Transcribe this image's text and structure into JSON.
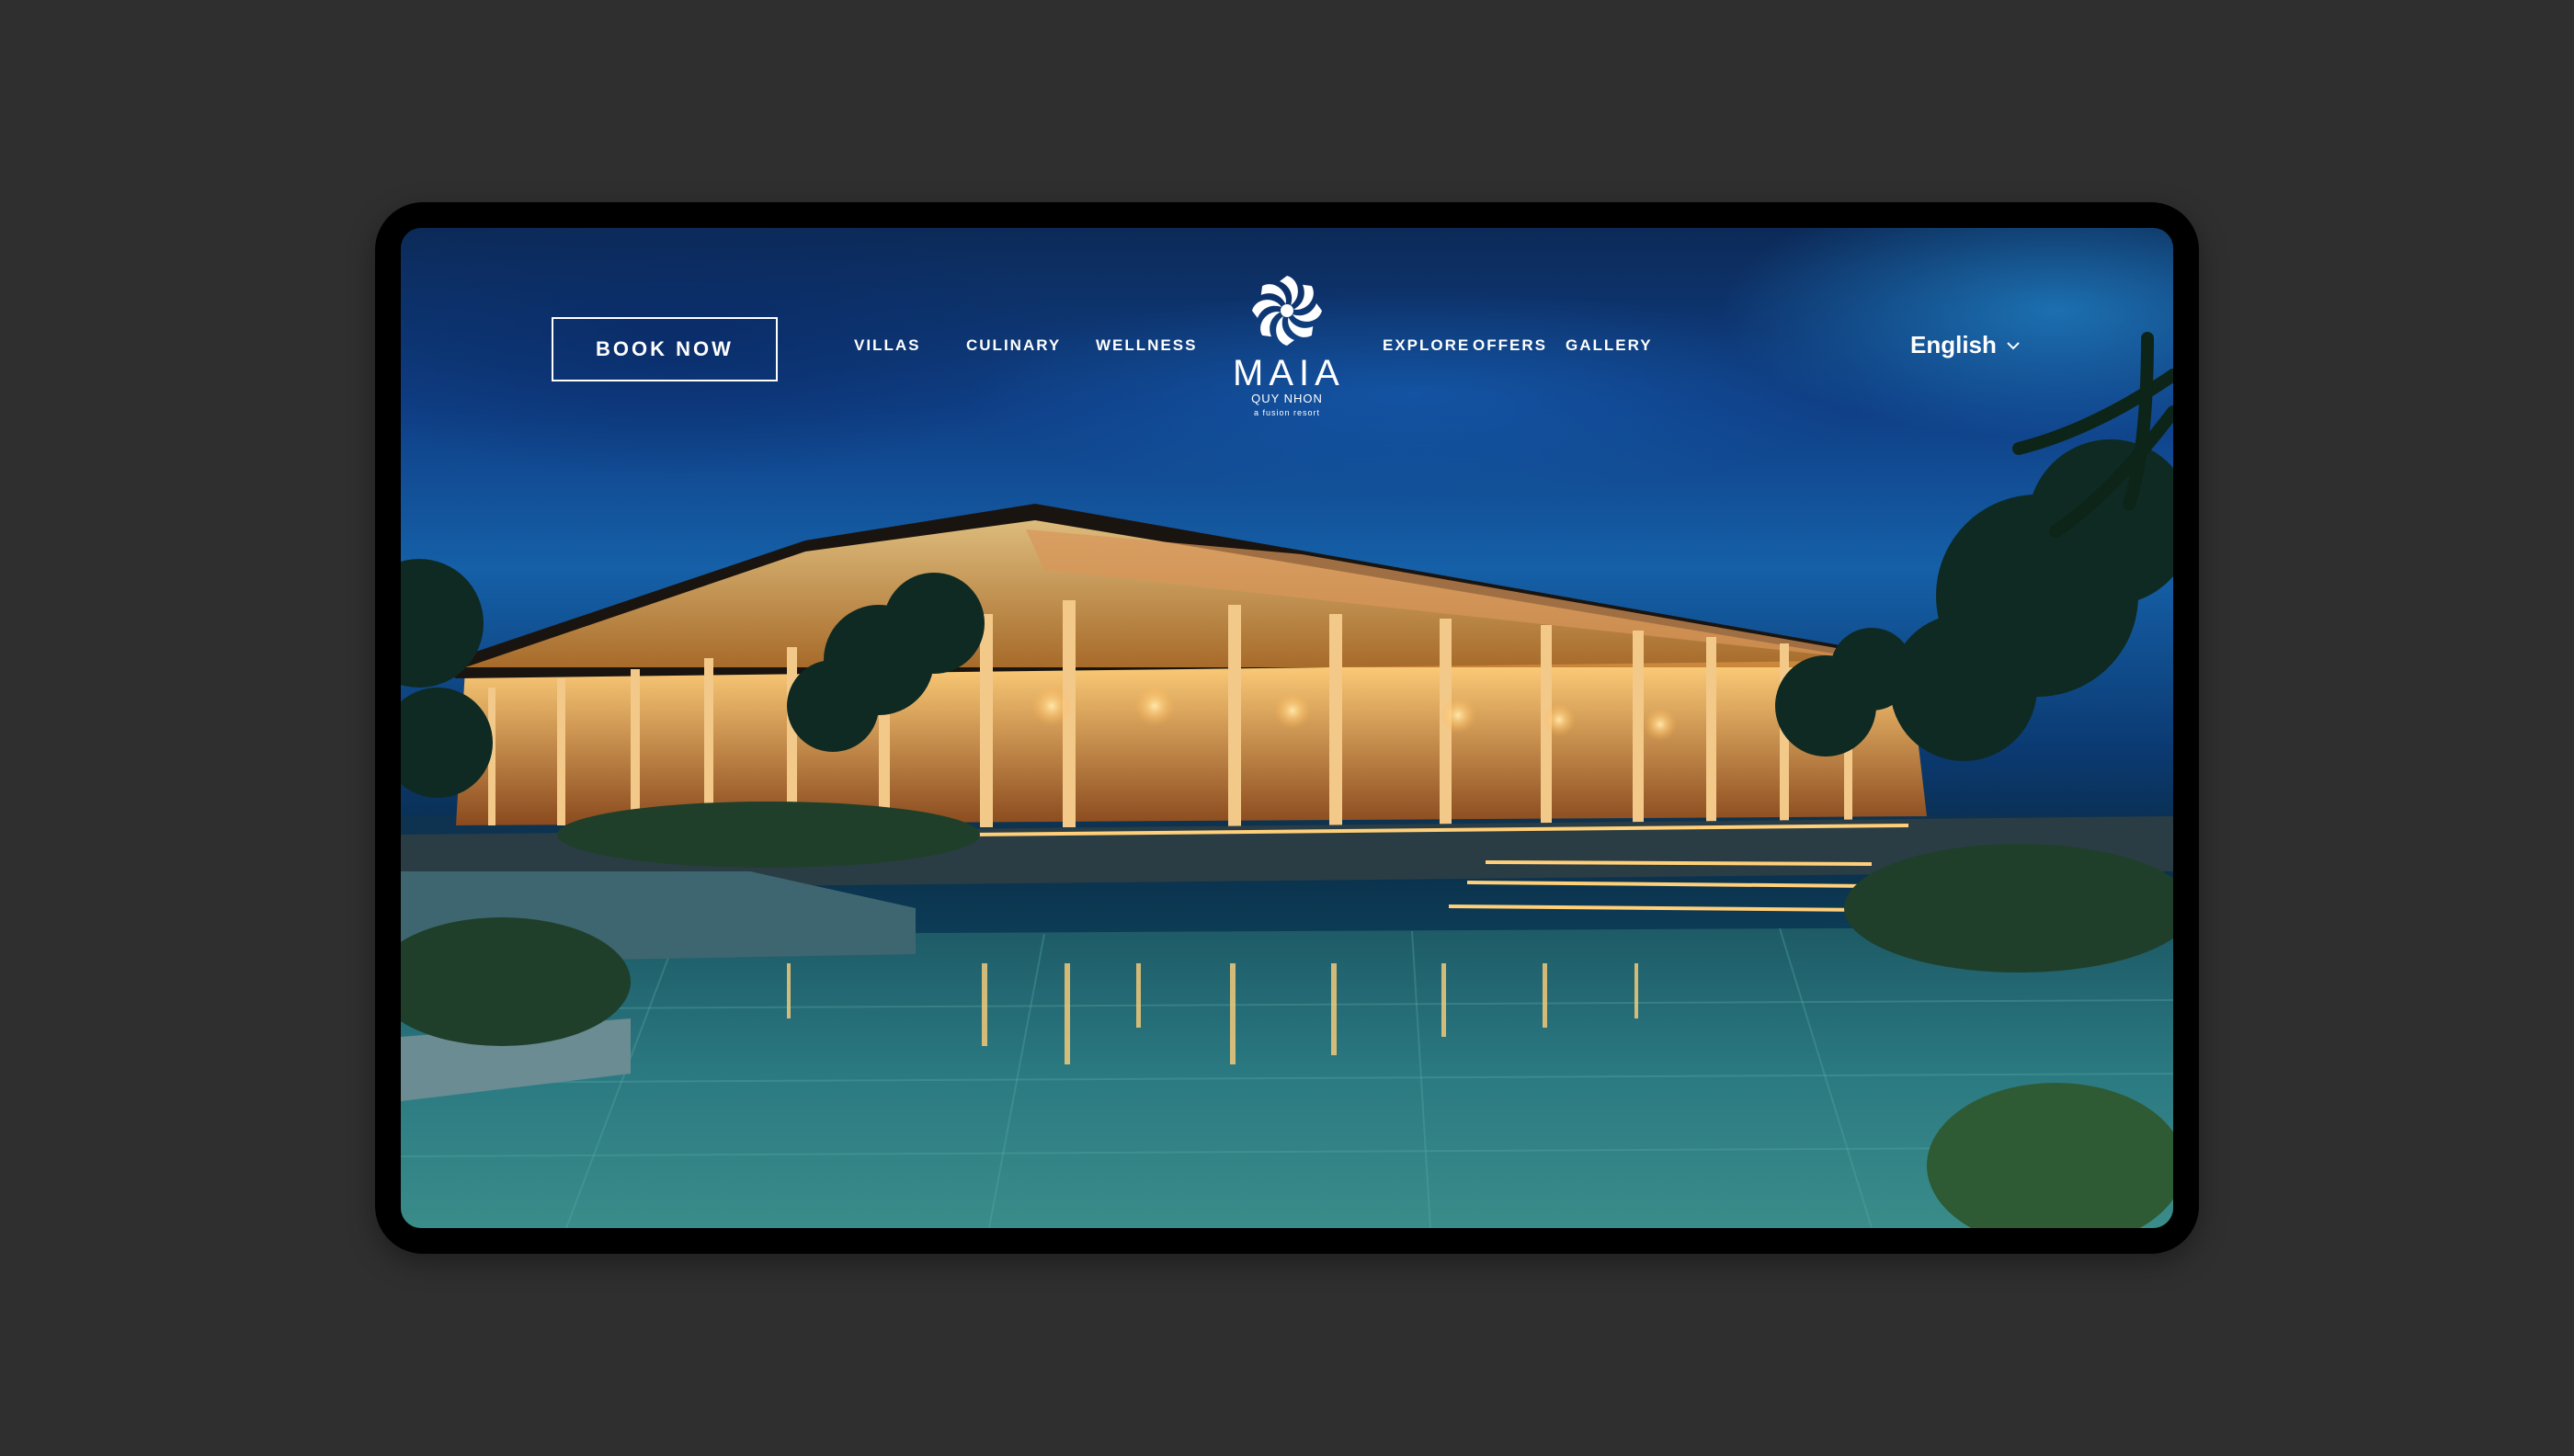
{
  "header": {
    "book_label": "BOOK NOW",
    "nav_left": [
      "VILLAS",
      "CULINARY",
      "WELLNESS"
    ],
    "nav_right": [
      "EXPLORE",
      "OFFERS",
      "GALLERY"
    ],
    "language": "English"
  },
  "logo": {
    "brand": "MAIA",
    "location": "QUY NHON",
    "tagline": "a fusion resort"
  },
  "icons": {
    "logo_mark": "flower-logo-icon",
    "language_caret": "chevron-down-icon"
  },
  "colors": {
    "page_background": "#2f2f2f",
    "nav_text": "#ffffff",
    "warm_light": "#ffb24d",
    "sky_blue": "#1560a8",
    "pool_teal": "#2a7d86"
  }
}
